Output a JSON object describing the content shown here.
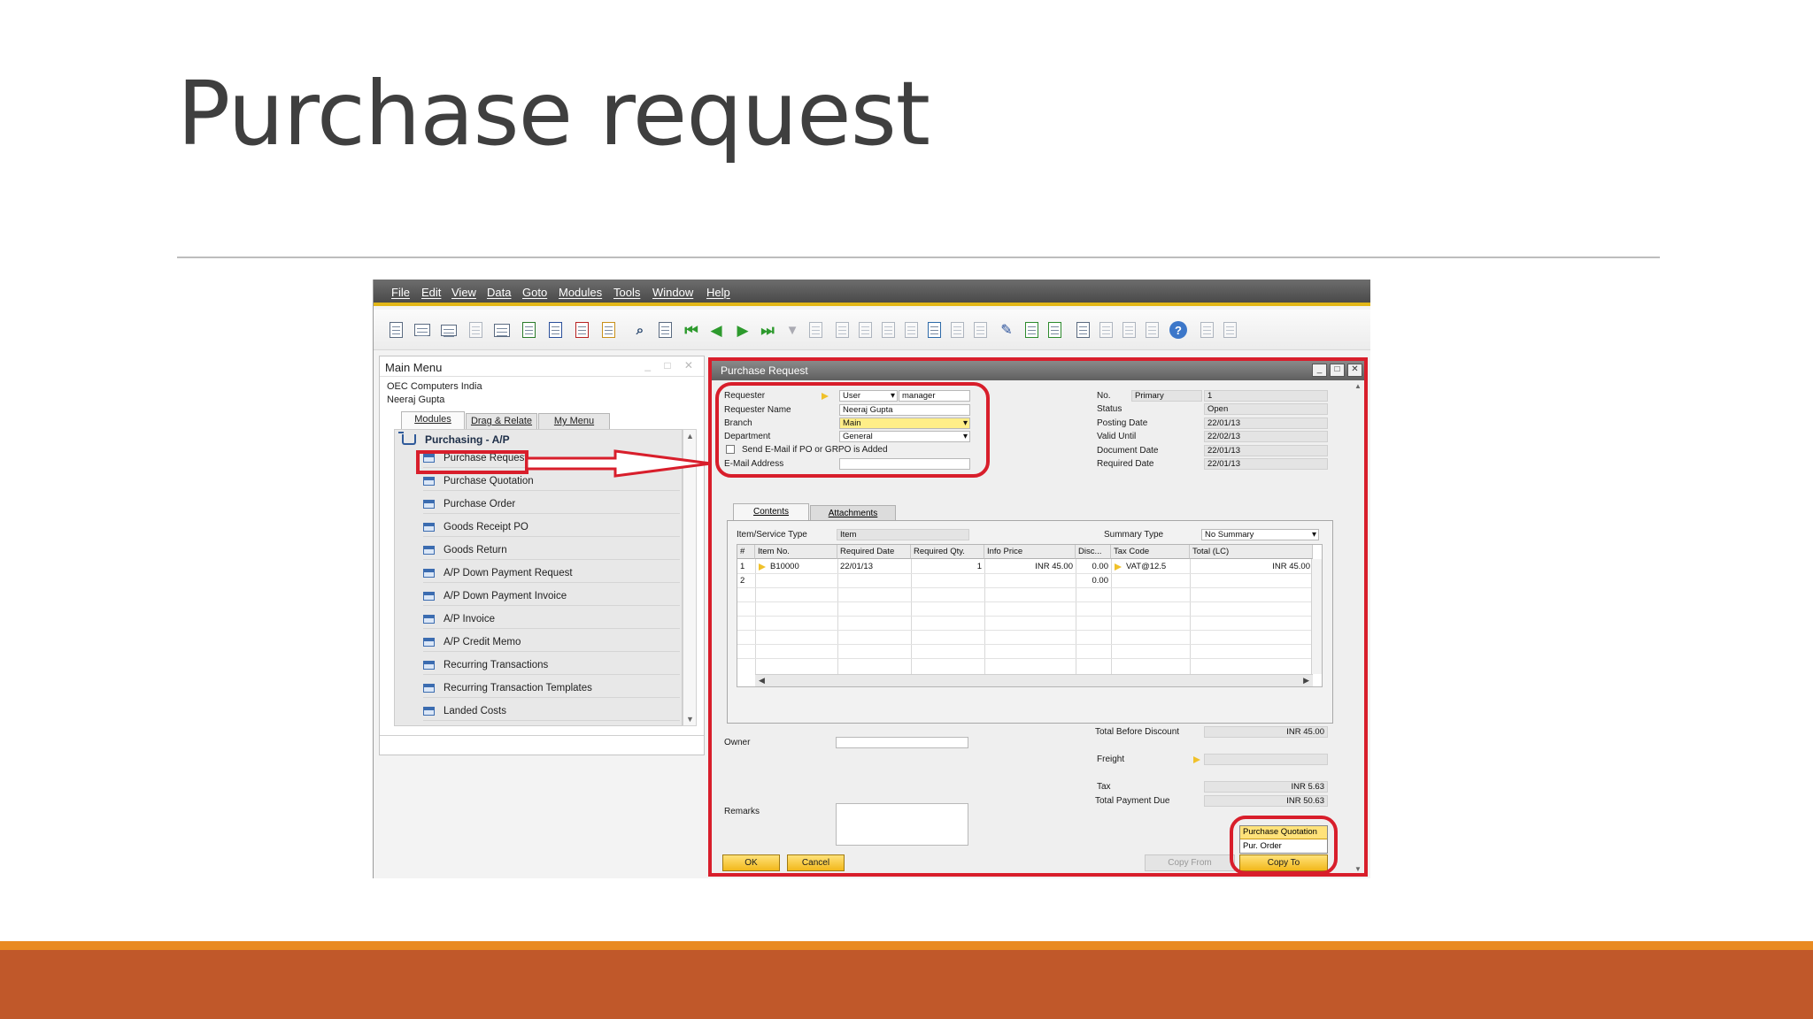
{
  "slide": {
    "title": "Purchase request"
  },
  "menubar": [
    "File",
    "Edit",
    "View",
    "Data",
    "Goto",
    "Modules",
    "Tools",
    "Window",
    "Help"
  ],
  "toolbar_icons": [
    "preview-icon",
    "print-icon",
    "email-icon",
    "sms-icon",
    "fax-icon",
    "excel-icon",
    "word-icon",
    "pdf-icon",
    "lock-icon",
    "find-icon",
    "add-icon",
    "first-record-icon",
    "previous-record-icon",
    "next-record-icon",
    "last-record-icon",
    "filter-icon",
    "sort-icon",
    "base-document-icon",
    "target-document-icon",
    "journal-icon",
    "gross-profit-icon",
    "calendar-icon",
    "settings-icon",
    "layout-designer-icon",
    "edit-icon",
    "new-icon",
    "approve-icon",
    "query-icon",
    "drag-icon",
    "report-icon",
    "structure-icon",
    "help-icon",
    "messages-icon",
    "alerts-icon"
  ],
  "main_menu": {
    "title": "Main Menu",
    "company": "OEC Computers India",
    "user": "Neeraj Gupta",
    "tabs": [
      "Modules",
      "Drag & Relate",
      "My Menu"
    ],
    "group": "Purchasing - A/P",
    "items": [
      "Purchase Request",
      "Purchase Quotation",
      "Purchase Order",
      "Goods Receipt PO",
      "Goods Return",
      "A/P Down Payment Request",
      "A/P Down Payment Invoice",
      "A/P Invoice",
      "A/P Credit Memo",
      "Recurring Transactions",
      "Recurring Transaction Templates",
      "Landed Costs"
    ]
  },
  "purchase_request": {
    "title": "Purchase Request",
    "header_left": {
      "requester_label": "Requester",
      "requester_type": "User",
      "requester_value": "manager",
      "requester_name_label": "Requester Name",
      "requester_name": "Neeraj Gupta",
      "branch_label": "Branch",
      "branch": "Main",
      "department_label": "Department",
      "department": "General",
      "send_email_label": "Send E-Mail if PO or GRPO is Added",
      "email_label": "E-Mail Address",
      "email": ""
    },
    "header_right": {
      "no_label": "No.",
      "series": "Primary",
      "no": "1",
      "status_label": "Status",
      "status": "Open",
      "posting_date_label": "Posting Date",
      "posting_date": "22/01/13",
      "valid_until_label": "Valid Until",
      "valid_until": "22/02/13",
      "document_date_label": "Document Date",
      "document_date": "22/01/13",
      "required_date_label": "Required Date",
      "required_date": "22/01/13"
    },
    "tabs": [
      "Contents",
      "Attachments"
    ],
    "item_type_label": "Item/Service Type",
    "item_type": "Item",
    "summary_type_label": "Summary Type",
    "summary_type": "No Summary",
    "columns": [
      "#",
      "Item No.",
      "Required Date",
      "Required Qty.",
      "Info Price",
      "Disc...",
      "Tax Code",
      "Total (LC)"
    ],
    "rows": [
      {
        "num": "1",
        "item_no": "B10000",
        "required_date": "22/01/13",
        "qty": "1",
        "info_price": "INR 45.00",
        "disc": "0.00",
        "tax_code": "VAT@12.5",
        "total": "INR 45.00"
      },
      {
        "num": "2",
        "item_no": "",
        "required_date": "",
        "qty": "",
        "info_price": "",
        "disc": "0.00",
        "tax_code": "",
        "total": ""
      }
    ],
    "owner_label": "Owner",
    "owner": "",
    "remarks_label": "Remarks",
    "remarks": "",
    "totals": {
      "before_discount_label": "Total Before Discount",
      "before_discount": "INR 45.00",
      "freight_label": "Freight",
      "freight": "",
      "tax_label": "Tax",
      "tax": "INR 5.63",
      "payment_due_label": "Total Payment Due",
      "payment_due": "INR 50.63"
    },
    "buttons": {
      "ok": "OK",
      "cancel": "Cancel",
      "copy_from": "Copy From",
      "copy_to": "Copy To"
    },
    "copy_to_menu": [
      "Purchase Quotation",
      "Pur. Order"
    ]
  }
}
